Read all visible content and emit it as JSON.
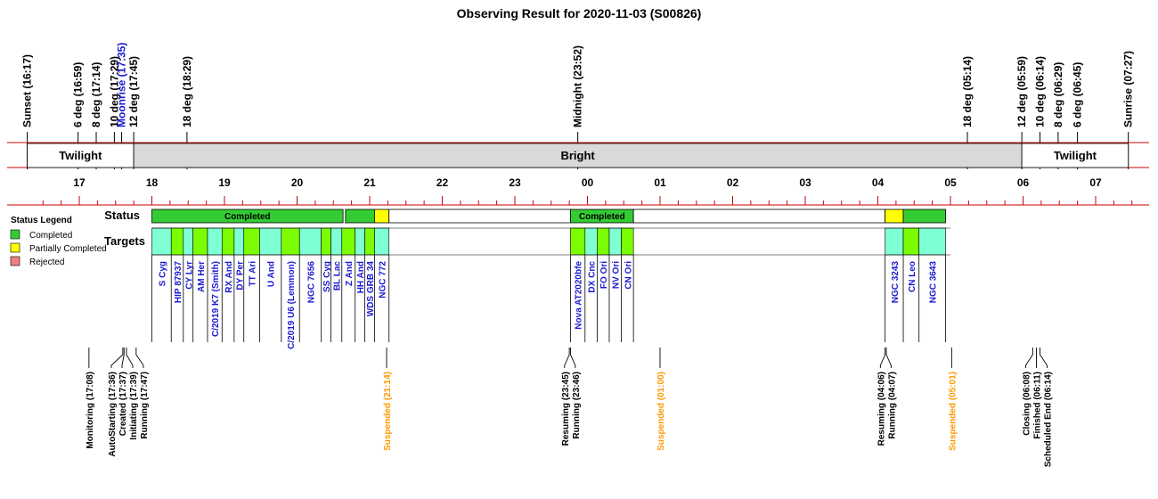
{
  "chart_data": {
    "type": "timeline",
    "title": "Observing Result for 2020-11-03 (S00826)",
    "time_axis": {
      "start": "16:20",
      "end": "07:33",
      "hour_labels": [
        "17",
        "18",
        "19",
        "20",
        "21",
        "22",
        "23",
        "00",
        "01",
        "02",
        "03",
        "04",
        "05",
        "06",
        "07"
      ]
    },
    "sun_events": [
      {
        "label": "Sunset (16:17)",
        "time": "16:17",
        "color": "#000000"
      },
      {
        "label": "6 deg (16:59)",
        "time": "16:59",
        "color": "#000000"
      },
      {
        "label": "8 deg (17:14)",
        "time": "17:14",
        "color": "#000000"
      },
      {
        "label": "10 deg (17:29)",
        "time": "17:29",
        "color": "#000000"
      },
      {
        "label": "Moonrise (17:35)",
        "time": "17:35",
        "color": "#1a1ad0"
      },
      {
        "label": "12 deg (17:45)",
        "time": "17:45",
        "color": "#000000"
      },
      {
        "label": "18 deg (18:29)",
        "time": "18:29",
        "color": "#000000"
      },
      {
        "label": "Midnight (23:52)",
        "time": "23:52",
        "color": "#000000"
      },
      {
        "label": "18 deg (05:14)",
        "time": "05:14",
        "color": "#000000"
      },
      {
        "label": "12 deg (05:59)",
        "time": "05:59",
        "color": "#000000"
      },
      {
        "label": "10 deg (06:14)",
        "time": "06:14",
        "color": "#000000"
      },
      {
        "label": "8 deg (06:29)",
        "time": "06:29",
        "color": "#000000"
      },
      {
        "label": "6 deg (06:45)",
        "time": "06:45",
        "color": "#000000"
      },
      {
        "label": "Sunrise (07:27)",
        "time": "07:27",
        "color": "#000000"
      }
    ],
    "sky_bands": [
      {
        "label": "Twilight",
        "start": "16:17",
        "end": "17:45",
        "fill": "#ffffff"
      },
      {
        "label": "Bright",
        "start": "17:45",
        "end": "05:59",
        "fill": "#d9d9d9"
      },
      {
        "label": "Twilight",
        "start": "05:59",
        "end": "07:27",
        "fill": "#ffffff"
      }
    ],
    "rows": {
      "status": "Status",
      "targets": "Targets"
    },
    "status_blocks": [
      {
        "start": "18:00",
        "end": "20:38",
        "state": "completed",
        "label": "Completed"
      },
      {
        "start": "20:40",
        "end": "21:04",
        "state": "completed",
        "label": ""
      },
      {
        "start": "21:04",
        "end": "21:16",
        "state": "partial",
        "label": ""
      },
      {
        "start": "21:16",
        "end": "23:46",
        "state": "none",
        "label": ""
      },
      {
        "start": "23:46",
        "end": "00:38",
        "state": "completed",
        "label": "Completed"
      },
      {
        "start": "00:38",
        "end": "04:06",
        "state": "none",
        "label": ""
      },
      {
        "start": "04:06",
        "end": "04:21",
        "state": "partial",
        "label": ""
      },
      {
        "start": "04:21",
        "end": "04:56",
        "state": "completed",
        "label": ""
      }
    ],
    "targets": [
      {
        "name": "S Cyg",
        "start": "18:00",
        "end": "18:16",
        "color": "aqua"
      },
      {
        "name": "HIP 87937",
        "start": "18:16",
        "end": "18:26",
        "color": "green"
      },
      {
        "name": "CY Lyr",
        "start": "18:26",
        "end": "18:34",
        "color": "aqua"
      },
      {
        "name": "AM Her",
        "start": "18:34",
        "end": "18:46",
        "color": "green"
      },
      {
        "name": "C/2019 K7 (Smith)",
        "start": "18:46",
        "end": "18:58",
        "color": "aqua"
      },
      {
        "name": "RX And",
        "start": "18:58",
        "end": "19:08",
        "color": "green"
      },
      {
        "name": "DY Per",
        "start": "19:08",
        "end": "19:16",
        "color": "aqua"
      },
      {
        "name": "TT Ari",
        "start": "19:16",
        "end": "19:29",
        "color": "green"
      },
      {
        "name": "U And",
        "start": "19:29",
        "end": "19:47",
        "color": "aqua"
      },
      {
        "name": "C/2019 U6 (Lemmon)",
        "start": "19:47",
        "end": "20:02",
        "color": "green"
      },
      {
        "name": "NGC 7656",
        "start": "20:02",
        "end": "20:20",
        "color": "aqua"
      },
      {
        "name": "SS Cyg",
        "start": "20:20",
        "end": "20:28",
        "color": "green"
      },
      {
        "name": "BL Lac",
        "start": "20:28",
        "end": "20:37",
        "color": "aqua"
      },
      {
        "name": "Z And",
        "start": "20:37",
        "end": "20:48",
        "color": "green"
      },
      {
        "name": "HH And",
        "start": "20:48",
        "end": "20:56",
        "color": "aqua"
      },
      {
        "name": "WDS GRB 34",
        "start": "20:56",
        "end": "21:04",
        "color": "green"
      },
      {
        "name": "NGC 772",
        "start": "21:04",
        "end": "21:16",
        "color": "aqua"
      },
      {
        "name": "Nova AT2020bfe",
        "start": "23:46",
        "end": "23:58",
        "color": "green"
      },
      {
        "name": "DX Cnc",
        "start": "23:58",
        "end": "00:08",
        "color": "aqua"
      },
      {
        "name": "FO Ori",
        "start": "00:08",
        "end": "00:18",
        "color": "green"
      },
      {
        "name": "NV Ori",
        "start": "00:18",
        "end": "00:28",
        "color": "aqua"
      },
      {
        "name": "CN Ori",
        "start": "00:28",
        "end": "00:38",
        "color": "green"
      },
      {
        "name": "NGC 3243",
        "start": "04:06",
        "end": "04:21",
        "color": "aqua"
      },
      {
        "name": "CN Leo",
        "start": "04:21",
        "end": "04:34",
        "color": "green"
      },
      {
        "name": "NGC 3643",
        "start": "04:34",
        "end": "04:56",
        "color": "aqua"
      }
    ],
    "log_events": [
      {
        "label": "Monitoring (17:08)",
        "time": "17:08",
        "color": "#000000"
      },
      {
        "label": "AutoStarting (17:36)",
        "time": "17:36",
        "color": "#000000"
      },
      {
        "label": "Created (17:37)",
        "time": "17:37",
        "color": "#000000"
      },
      {
        "label": "Initiating (17:39)",
        "time": "17:39",
        "color": "#000000"
      },
      {
        "label": "Running (17:47)",
        "time": "17:47",
        "color": "#000000"
      },
      {
        "label": "Suspended (21:14)",
        "time": "21:14",
        "color": "#ff9900"
      },
      {
        "label": "Resuming (23:45)",
        "time": "23:45",
        "color": "#000000"
      },
      {
        "label": "Running (23:46)",
        "time": "23:46",
        "color": "#000000"
      },
      {
        "label": "Suspended (01:00)",
        "time": "01:00",
        "color": "#ff9900"
      },
      {
        "label": "Resuming (04:06)",
        "time": "04:06",
        "color": "#000000"
      },
      {
        "label": "Running (04:07)",
        "time": "04:07",
        "color": "#000000"
      },
      {
        "label": "Suspended (05:01)",
        "time": "05:01",
        "color": "#ff9900"
      },
      {
        "label": "Closing (06:08)",
        "time": "06:08",
        "color": "#000000"
      },
      {
        "label": "Finished (06:11)",
        "time": "06:11",
        "color": "#000000"
      },
      {
        "label": "Scheduled End (06:14)",
        "time": "06:14",
        "color": "#000000"
      }
    ],
    "legend": {
      "title": "Status Legend",
      "placement": "left",
      "items": [
        {
          "label": "Completed",
          "color": "#33cc33"
        },
        {
          "label": "Partially Completed",
          "color": "#ffff00"
        },
        {
          "label": "Rejected",
          "color": "#f08080"
        }
      ]
    },
    "colors": {
      "axis_red": "#cc0000",
      "completed": "#33cc33",
      "partial": "#ffff00",
      "target_aqua": "#7fffd4",
      "target_green": "#7cfc00",
      "target_label": "#1a1ad0",
      "suspended": "#ff9900"
    }
  }
}
